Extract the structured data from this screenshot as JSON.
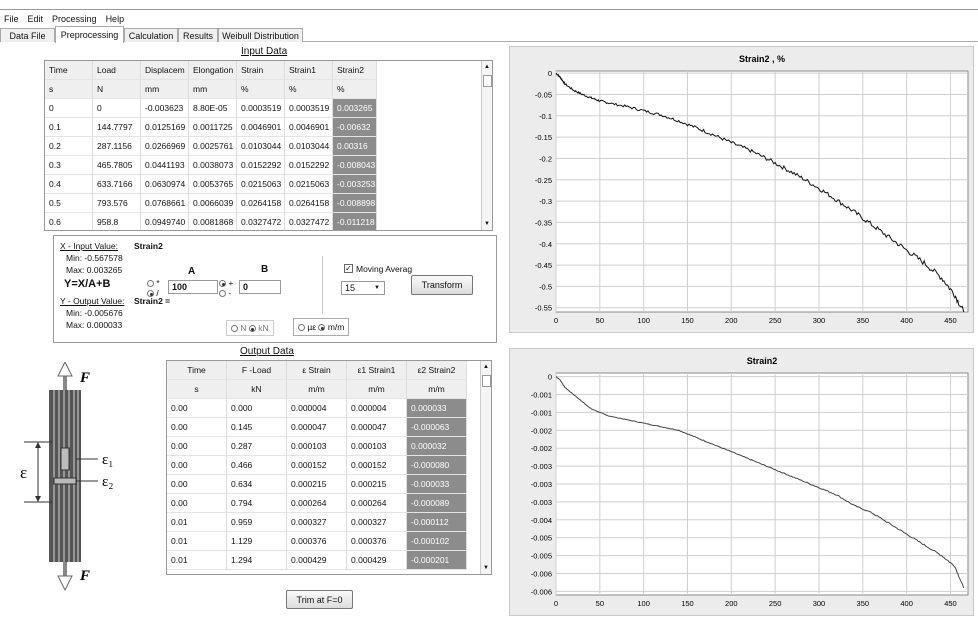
{
  "menu": [
    "File",
    "Edit",
    "Processing",
    "Help"
  ],
  "tabs": [
    {
      "label": "Data File",
      "active": false
    },
    {
      "label": "Preprocessing",
      "active": true
    },
    {
      "label": "Calculation",
      "active": false
    },
    {
      "label": "Results",
      "active": false
    },
    {
      "label": "Weibull Distribution",
      "active": false
    }
  ],
  "input_grid": {
    "title": "Input Data",
    "columns": [
      "Time",
      "Load",
      "Displacem",
      "Elongation",
      "Strain",
      "Strain1",
      "Strain2"
    ],
    "units": [
      "s",
      "N",
      "mm",
      "mm",
      "%",
      "%",
      "%"
    ],
    "rows": [
      [
        "0",
        "0",
        "-0.003623",
        "8.80E-05",
        "0.0003519",
        "0.0003519",
        "0.003265"
      ],
      [
        "0.1",
        "144.7797",
        "0.0125169",
        "0.0011725",
        "0.0046901",
        "0.0046901",
        "-0.00632"
      ],
      [
        "0.2",
        "287.1156",
        "0.0266969",
        "0.0025761",
        "0.0103044",
        "0.0103044",
        "0.00316"
      ],
      [
        "0.3",
        "465.7805",
        "0.0441193",
        "0.0038073",
        "0.0152292",
        "0.0152292",
        "-0.008043"
      ],
      [
        "0.4",
        "633.7166",
        "0.0630974",
        "0.0053765",
        "0.0215063",
        "0.0215063",
        "-0.003253"
      ],
      [
        "0.5",
        "793.576",
        "0.0768661",
        "0.0066039",
        "0.0264158",
        "0.0264158",
        "-0.008898"
      ],
      [
        "0.6",
        "958.8",
        "0.0949740",
        "0.0081868",
        "0.0327472",
        "0.0327472",
        "-0.011218"
      ]
    ]
  },
  "transform": {
    "x_label": "X - Input Value:",
    "x_name": "Strain2",
    "x_min": "Min: -0.567578",
    "x_max": "Max: 0.003265",
    "formula": "Y=X/A+B",
    "y_label": "Y - Output Value:",
    "y_name": "Strain2 =",
    "y_min": "Min: -0.005676",
    "y_max": "Max: 0.000033",
    "a_label": "A",
    "b_label": "B",
    "a_value": "100",
    "b_value": "0",
    "op_mul": "*",
    "op_div": "/",
    "op_plus": "+",
    "op_minus": "-",
    "moving_average_label": "Moving Averag",
    "moving_average_checked": true,
    "window_value": "15",
    "transform_button": "Transform",
    "unit_n": "N",
    "unit_kn": "kN",
    "unit_micro": "µε",
    "unit_mm": "m/m"
  },
  "specimen": {
    "force_top": "F",
    "force_bottom": "F",
    "epsilon": "ε",
    "eps1": "ε₁",
    "eps2": "ε₂"
  },
  "output_grid": {
    "title": "Output Data",
    "columns": [
      "Time",
      "F -Load",
      "ε  Strain",
      "ε1  Strain1",
      "ε2  Strain2"
    ],
    "units": [
      "s",
      "kN",
      "m/m",
      "m/m",
      "m/m"
    ],
    "rows": [
      [
        "0.00",
        "0.000",
        "0.000004",
        "0.000004",
        "0.000033"
      ],
      [
        "0.00",
        "0.145",
        "0.000047",
        "0.000047",
        "-0.000063"
      ],
      [
        "0.00",
        "0.287",
        "0.000103",
        "0.000103",
        "0.000032"
      ],
      [
        "0.00",
        "0.466",
        "0.000152",
        "0.000152",
        "-0.000080"
      ],
      [
        "0.00",
        "0.634",
        "0.000215",
        "0.000215",
        "-0.000033"
      ],
      [
        "0.00",
        "0.794",
        "0.000264",
        "0.000264",
        "-0.000089"
      ],
      [
        "0.01",
        "0.959",
        "0.000327",
        "0.000327",
        "-0.000112"
      ],
      [
        "0.01",
        "1.129",
        "0.000376",
        "0.000376",
        "-0.000102"
      ],
      [
        "0.01",
        "1.294",
        "0.000429",
        "0.000429",
        "-0.000201"
      ]
    ],
    "trim_button": "Trim at F=0"
  },
  "chart_data": [
    {
      "type": "line",
      "title": "Strain2 , %",
      "xlim": [
        0,
        470
      ],
      "ylim": [
        -0.56,
        0.005
      ],
      "xticks": [
        0,
        50,
        100,
        150,
        200,
        250,
        300,
        350,
        400,
        450
      ],
      "yticks": [
        0,
        -0.05,
        -0.1,
        -0.15,
        -0.2,
        -0.25,
        -0.3,
        -0.35,
        -0.4,
        -0.45,
        -0.5,
        -0.55
      ],
      "x": [
        0,
        5,
        10,
        20,
        30,
        40,
        50,
        60,
        80,
        100,
        120,
        140,
        160,
        180,
        200,
        220,
        240,
        260,
        280,
        300,
        320,
        340,
        360,
        380,
        400,
        420,
        440,
        455,
        465
      ],
      "y": [
        0,
        -0.01,
        -0.025,
        -0.04,
        -0.05,
        -0.058,
        -0.065,
        -0.07,
        -0.078,
        -0.088,
        -0.098,
        -0.112,
        -0.128,
        -0.145,
        -0.163,
        -0.18,
        -0.2,
        -0.222,
        -0.245,
        -0.27,
        -0.297,
        -0.325,
        -0.355,
        -0.385,
        -0.415,
        -0.445,
        -0.48,
        -0.52,
        -0.56
      ],
      "noise": 0.01,
      "grid": true,
      "line_color": "#111111"
    },
    {
      "type": "line",
      "title": "Strain2",
      "xlim": [
        0,
        470
      ],
      "ylim": [
        -0.0061,
        0.0001
      ],
      "xticks": [
        0,
        50,
        100,
        150,
        200,
        250,
        300,
        350,
        400,
        450
      ],
      "yticks": [
        0,
        -0.0005,
        -0.001,
        -0.0015,
        -0.002,
        -0.0025,
        -0.003,
        -0.0035,
        -0.004,
        -0.0045,
        -0.005,
        -0.0055,
        -0.006
      ],
      "ytick_labels": [
        "0",
        "-0.001",
        "-0.001",
        "-0.002",
        "-0.002",
        "-0.003",
        "-0.003",
        "-0.003",
        "-0.004",
        "-0.005",
        "-0.005",
        "-0.006",
        "-0.006"
      ],
      "x": [
        0,
        5,
        10,
        20,
        30,
        40,
        50,
        60,
        80,
        100,
        120,
        140,
        160,
        180,
        200,
        220,
        240,
        260,
        280,
        300,
        320,
        340,
        360,
        380,
        400,
        420,
        440,
        455,
        465
      ],
      "y": [
        0,
        -0.0001,
        -0.0003,
        -0.0005,
        -0.0007,
        -0.0009,
        -0.001,
        -0.0011,
        -0.0012,
        -0.0013,
        -0.0014,
        -0.0015,
        -0.0017,
        -0.0019,
        -0.0021,
        -0.0023,
        -0.0025,
        -0.0027,
        -0.0029,
        -0.0031,
        -0.0033,
        -0.0036,
        -0.0038,
        -0.0041,
        -0.0044,
        -0.0047,
        -0.005,
        -0.0053,
        -0.0059
      ],
      "noise": 3e-05,
      "grid": true,
      "line_color": "#444444"
    }
  ]
}
